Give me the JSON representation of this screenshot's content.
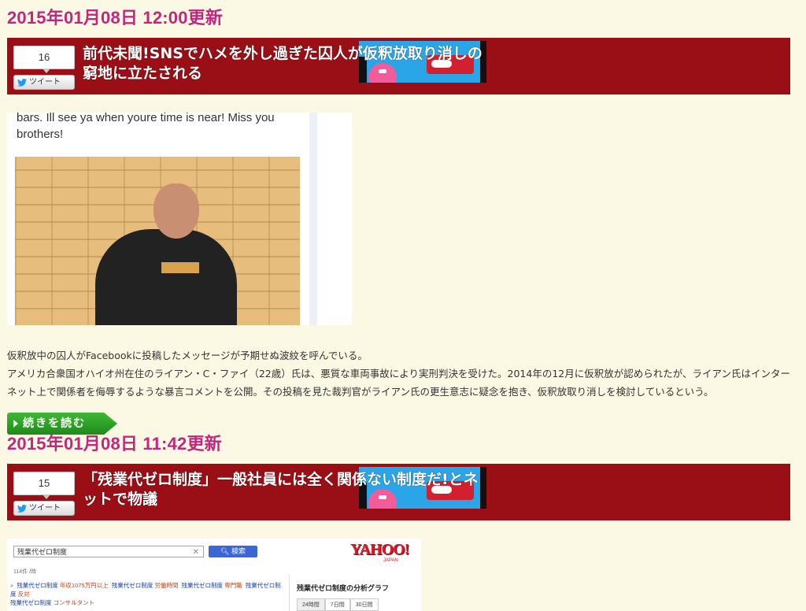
{
  "posts": [
    {
      "date": "2015年01月08日 12:00更新",
      "title": "前代未聞!SNSでハメを外し過ぎた囚人が仮釈放取り消しの窮地に立たされる",
      "count": "16",
      "tweet_label": "ツイート",
      "image_caption": "bars. Ill see ya when youre time is near! Miss you brothers!",
      "description": [
        "仮釈放中の囚人がFacebookに投稿したメッセージが予期せぬ波紋を呼んでいる。",
        "アメリカ合衆国オハイオ州在住のライアン・C・ファイ（22歳）氏は、悪質な車両事故により実刑判決を受けた。2014年の12月に仮釈放が認められたが、ライアン氏はインターネット上で関係者を侮辱するような暴言コメントを公開。その投稿を見た裁判官がライアン氏の更生意志に疑念を抱き、仮釈放取り消しを検討しているという。"
      ],
      "more_label": "続きを読む"
    },
    {
      "date": "2015年01月08日 11:42更新",
      "title": "「残業代ゼロ制度」一般社員には全く関係ない制度だ!とネットで物議",
      "count": "15",
      "tweet_label": "ツイート",
      "screenshot": {
        "search_value": "残業代ゼロ制度",
        "search_button": "検索",
        "logo": "YAHOO!",
        "logo_sub": "JAPAN",
        "result_count": "114件 /時",
        "related": [
          {
            "q": "残業代ゼロ制度",
            "sub": "年収1075万円以上"
          },
          {
            "q": "残業代ゼロ制度",
            "sub": "労働時間"
          },
          {
            "q": "残業代ゼロ制度",
            "sub": "専門職"
          },
          {
            "q": "残業代ゼロ制度",
            "sub": "反対"
          },
          {
            "q": "残業代ゼロ制度",
            "sub": "コンサルタント"
          }
        ],
        "side_title": "残業代ゼロ制度の分析グラフ",
        "tabs": [
          "24時間",
          "7日間",
          "30日間"
        ]
      }
    }
  ],
  "colors": {
    "background": "#fbf8e3",
    "date": "#c2277d",
    "title_bar": "#9a0f16",
    "more_button": "#2ea128"
  }
}
